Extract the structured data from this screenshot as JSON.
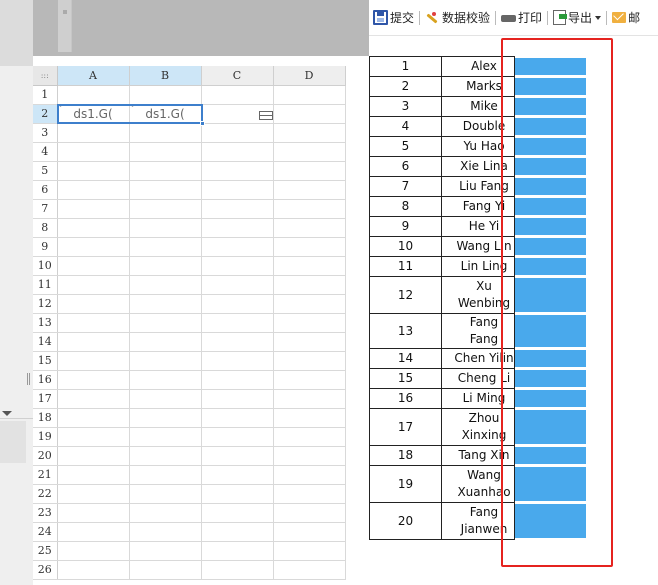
{
  "colors": {
    "accent": "#3d7fcc",
    "bar": "#49a9ec",
    "highlight_frame": "#e5231f",
    "header_highlight": "#cde6f7"
  },
  "sheet": {
    "corner_label": ":::",
    "columns": [
      "A",
      "B",
      "C",
      "D"
    ],
    "rows": [
      "1",
      "2",
      "3",
      "4",
      "5",
      "6",
      "7",
      "8",
      "9",
      "10",
      "11",
      "12",
      "13",
      "14",
      "15",
      "16",
      "17",
      "18",
      "19",
      "20",
      "21",
      "22",
      "23",
      "24",
      "25",
      "26"
    ],
    "cell_a2": "ds1.G(",
    "cell_b2": "ds1.G("
  },
  "toolbar": {
    "submit_label": "提交",
    "validate_label": "数据校验",
    "print_label": "打印",
    "export_label": "导出",
    "mail_label": "邮"
  },
  "report_rows": [
    {
      "no": "1",
      "name": "Alex",
      "multiline": false
    },
    {
      "no": "2",
      "name": "Marks",
      "multiline": false
    },
    {
      "no": "3",
      "name": "Mike",
      "multiline": false
    },
    {
      "no": "4",
      "name": "Double",
      "multiline": false
    },
    {
      "no": "5",
      "name": "Yu Hao",
      "multiline": false
    },
    {
      "no": "6",
      "name": "Xie Lina",
      "multiline": false
    },
    {
      "no": "7",
      "name": "Liu Fang",
      "multiline": false
    },
    {
      "no": "8",
      "name": "Fang Yi",
      "multiline": false
    },
    {
      "no": "9",
      "name": "He Yi",
      "multiline": false
    },
    {
      "no": "10",
      "name": "Wang Lin",
      "multiline": false
    },
    {
      "no": "11",
      "name": "Lin Ling",
      "multiline": false
    },
    {
      "no": "12",
      "name": "Xu Wenbing",
      "multiline": true
    },
    {
      "no": "13",
      "name": "Fang Fang",
      "multiline": false
    },
    {
      "no": "14",
      "name": "Chen Yilin",
      "multiline": false
    },
    {
      "no": "15",
      "name": "Cheng Li",
      "multiline": false
    },
    {
      "no": "16",
      "name": "Li Ming",
      "multiline": false
    },
    {
      "no": "17",
      "name": "Zhou Xinxing",
      "multiline": true
    },
    {
      "no": "18",
      "name": "Tang Xin",
      "multiline": false
    },
    {
      "no": "19",
      "name": "Wang Xuanhao",
      "multiline": true
    },
    {
      "no": "20",
      "name": "Fang Jianwen",
      "multiline": true
    }
  ]
}
